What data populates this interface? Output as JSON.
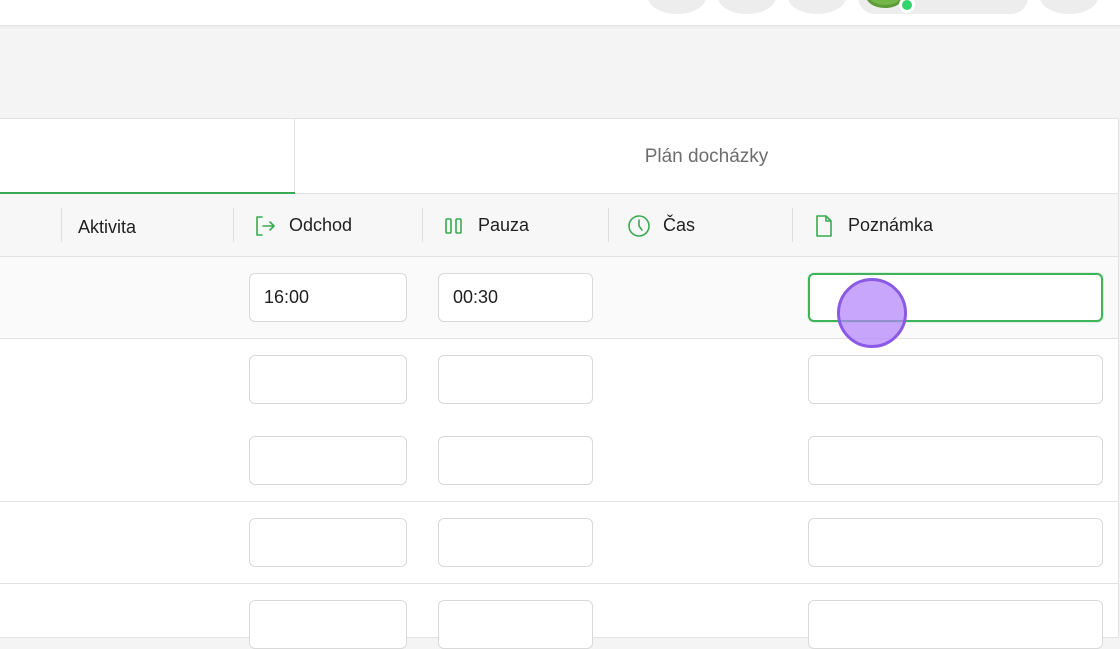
{
  "tabs": {
    "active_label": "",
    "plan_label": "Plán docházky"
  },
  "columns": {
    "aktivita": "Aktivita",
    "odchod": "Odchod",
    "pauza": "Pauza",
    "cas": "Čas",
    "poznamka": "Poznámka"
  },
  "rows": [
    {
      "odchod": "16:00",
      "pauza": "00:30",
      "poznamka": ""
    },
    {
      "odchod": "",
      "pauza": "",
      "poznamka": ""
    },
    {
      "odchod": "",
      "pauza": "",
      "poznamka": ""
    },
    {
      "odchod": "",
      "pauza": "",
      "poznamka": ""
    },
    {
      "odchod": "",
      "pauza": "",
      "poznamka": ""
    }
  ],
  "colors": {
    "accent": "#3aaa52",
    "cursor": "#b284fa"
  }
}
